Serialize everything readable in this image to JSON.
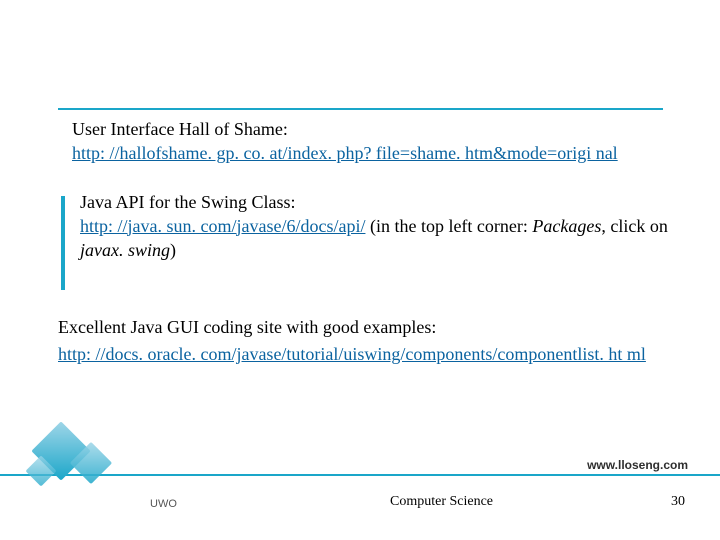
{
  "block1": {
    "title": "User Interface Hall of Shame:",
    "link_text": "http: //hallofshame. gp. co. at/index. php? file=shame. htm&mode=origi nal"
  },
  "block2": {
    "title": "Java API for the Swing Class:",
    "link_text": "http: //java. sun. com/javase/6/docs/api/",
    "paren_lead": " (in the top left corner: ",
    "paren_ital1": "Packages",
    "paren_mid": ", click on ",
    "paren_ital2": "javax. swing",
    "paren_tail": ")"
  },
  "block3": {
    "title": "Excellent Java GUI coding site with good examples:",
    "link_text": "http: //docs. oracle. com/javase/tutorial/uiswing/components/componentlist. ht ml"
  },
  "footer": {
    "site": "www.lloseng.com",
    "uwo": "UWO",
    "dept": "Computer Science",
    "page": "30"
  }
}
